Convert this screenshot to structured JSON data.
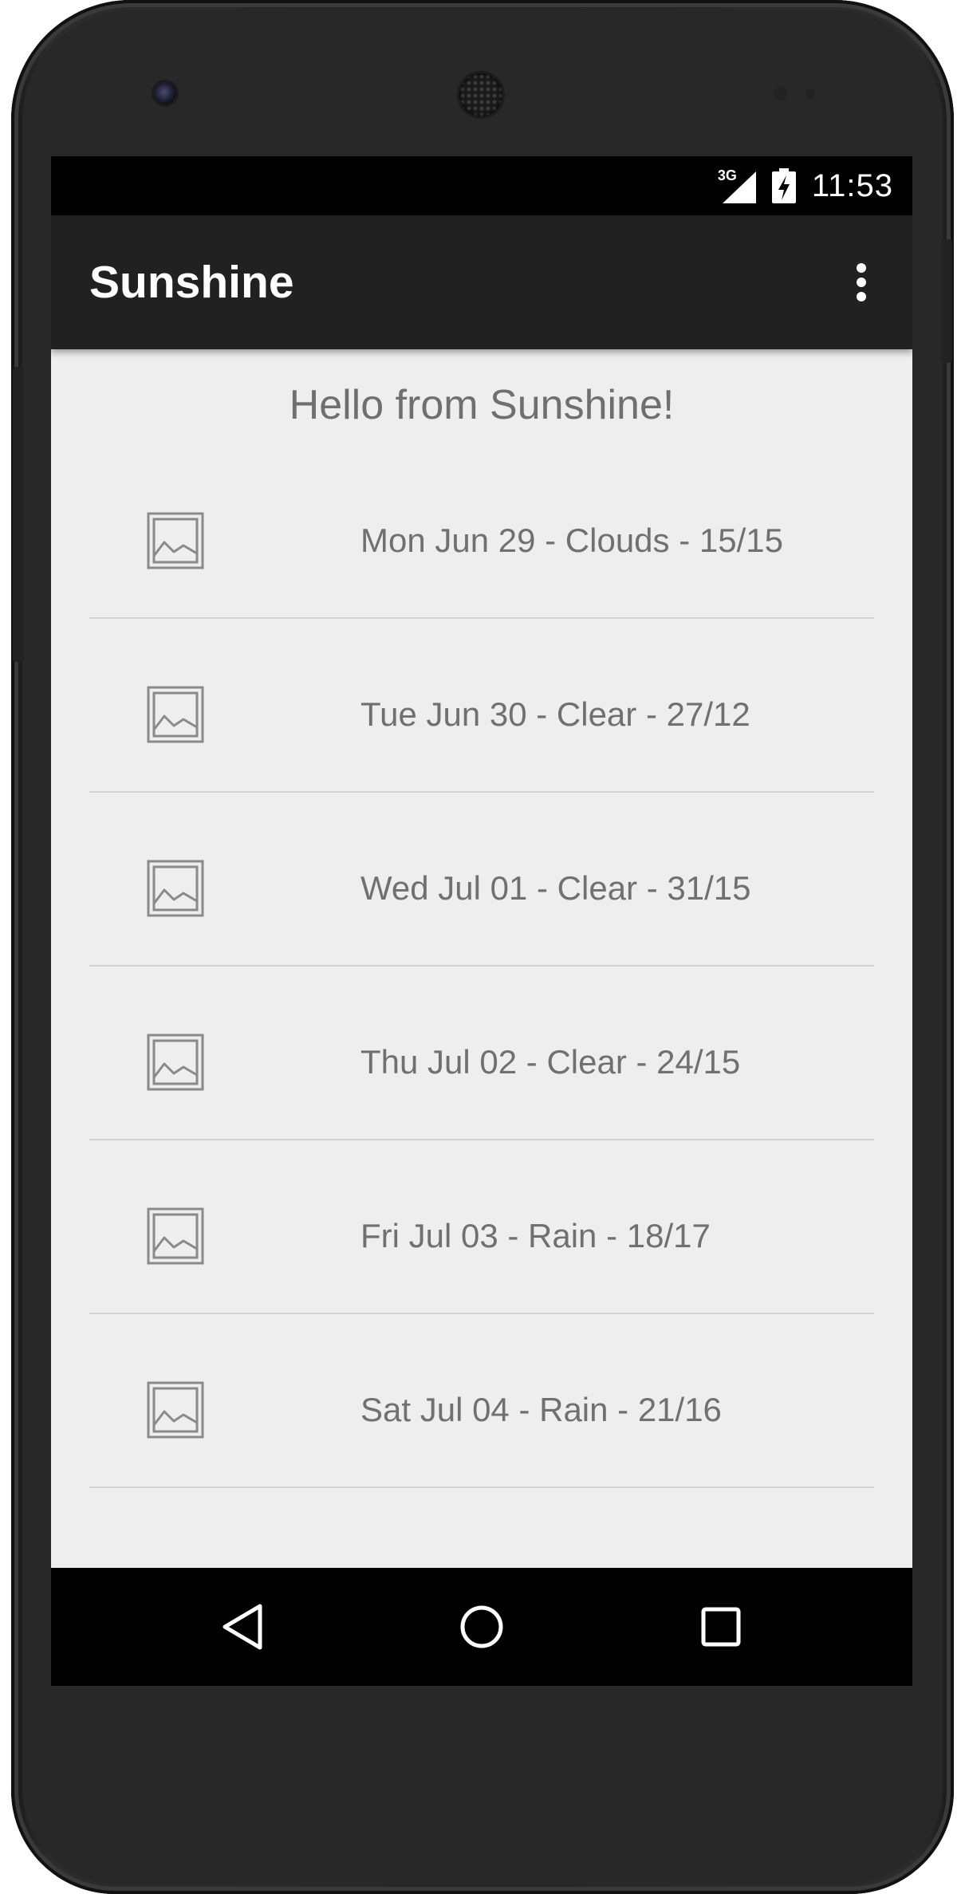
{
  "status_bar": {
    "network_label": "3G",
    "time": "11:53",
    "icons": [
      "signal-icon",
      "battery-charging-icon"
    ]
  },
  "app_bar": {
    "title": "Sunshine",
    "overflow_icon": "more-vert-icon",
    "color": "#212121"
  },
  "main": {
    "greeting": "Hello from Sunshine!",
    "background": "#eeeeee",
    "forecast": [
      {
        "text": "Mon Jun 29 - Clouds - 15/15",
        "icon": "image-placeholder-icon"
      },
      {
        "text": "Tue Jun 30 - Clear - 27/12",
        "icon": "image-placeholder-icon"
      },
      {
        "text": "Wed Jul 01 - Clear - 31/15",
        "icon": "image-placeholder-icon"
      },
      {
        "text": "Thu Jul 02 - Clear - 24/15",
        "icon": "image-placeholder-icon"
      },
      {
        "text": "Fri Jul 03 - Rain - 18/17",
        "icon": "image-placeholder-icon"
      },
      {
        "text": "Sat Jul 04 - Rain - 21/16",
        "icon": "image-placeholder-icon"
      }
    ]
  },
  "nav_bar": {
    "buttons": [
      "back-icon",
      "home-icon",
      "recents-icon"
    ]
  }
}
